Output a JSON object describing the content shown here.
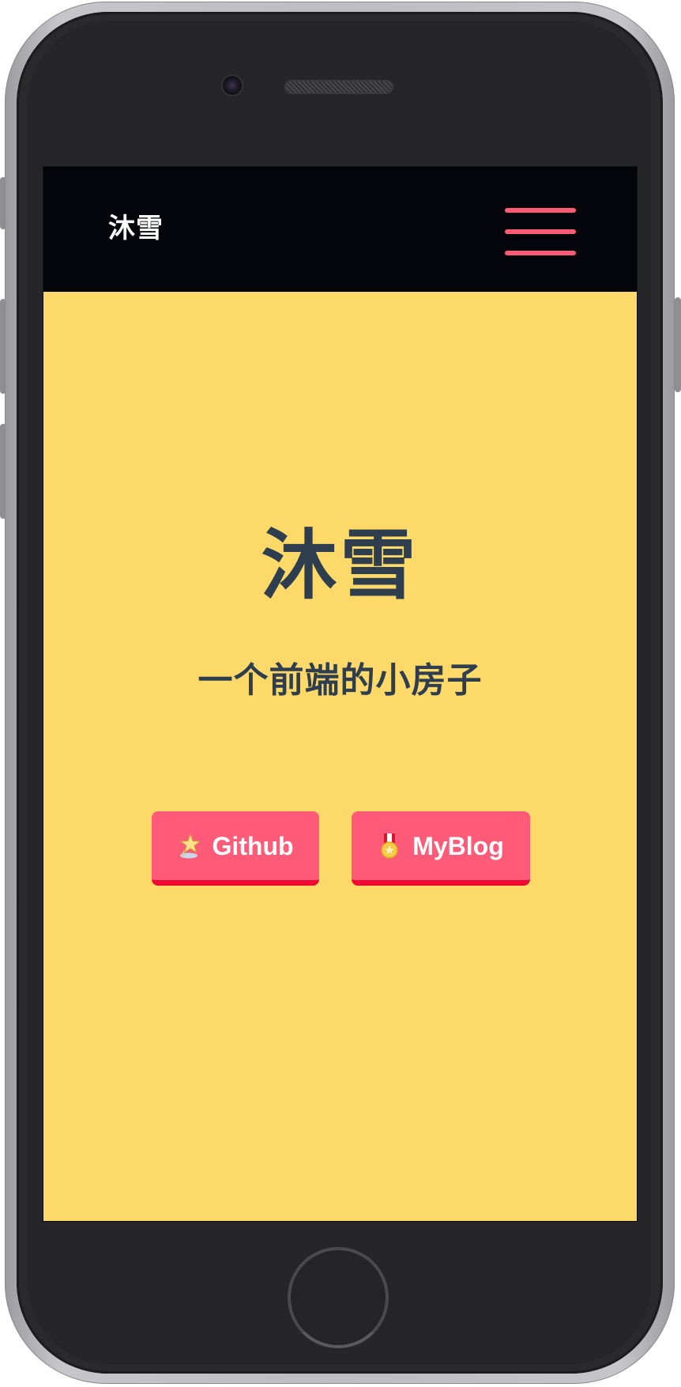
{
  "navbar": {
    "brand": "沐雪",
    "menu_icon": "hamburger-icon",
    "accent_color": "#ff5a75",
    "background_color": "#03050a"
  },
  "hero": {
    "title": "沐雪",
    "subtitle": "一个前端的小房子",
    "background_color": "#fdd96a",
    "text_color": "#2e3e4e"
  },
  "buttons": [
    {
      "label": "Github",
      "icon": "shooting-star-icon"
    },
    {
      "label": "MyBlog",
      "icon": "medal-icon"
    }
  ],
  "button_colors": {
    "fill": "#ff5a78",
    "border_bottom": "#ee0a32"
  }
}
